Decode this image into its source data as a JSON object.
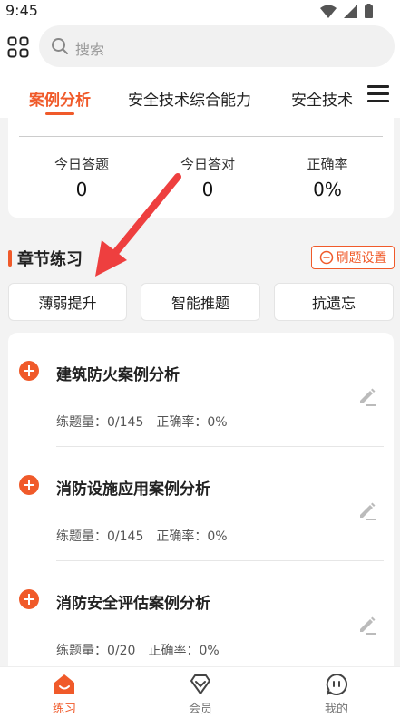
{
  "status_bar": {
    "time": "9:45"
  },
  "search": {
    "placeholder": "搜索"
  },
  "tabs": [
    {
      "label": "案例分析",
      "active": true
    },
    {
      "label": "安全技术综合能力",
      "active": false
    },
    {
      "label": "安全技术",
      "active": false
    }
  ],
  "stats": [
    {
      "label": "今日答题",
      "value": "0"
    },
    {
      "label": "今日答对",
      "value": "0"
    },
    {
      "label": "正确率",
      "value": "0%"
    }
  ],
  "chapter": {
    "title": "章节练习",
    "settings_label": "刷题设置",
    "buttons": [
      "薄弱提升",
      "智能推题",
      "抗遗忘"
    ]
  },
  "chapters": [
    {
      "title": "建筑防火案例分析",
      "count_label": "练题量：0/145",
      "accuracy_label": "正确率：0%"
    },
    {
      "title": "消防设施应用案例分析",
      "count_label": "练题量：0/145",
      "accuracy_label": "正确率：0%"
    },
    {
      "title": "消防安全评估案例分析",
      "count_label": "练题量：0/20",
      "accuracy_label": "正确率：0%"
    }
  ],
  "bottom_nav": [
    {
      "label": "练习",
      "icon": "practice-icon",
      "active": true
    },
    {
      "label": "会员",
      "icon": "diamond-icon",
      "active": false
    },
    {
      "label": "我的",
      "icon": "chat-bubble-icon",
      "active": false
    }
  ],
  "colors": {
    "accent": "#f05a2a",
    "background": "#f3f3f3"
  }
}
